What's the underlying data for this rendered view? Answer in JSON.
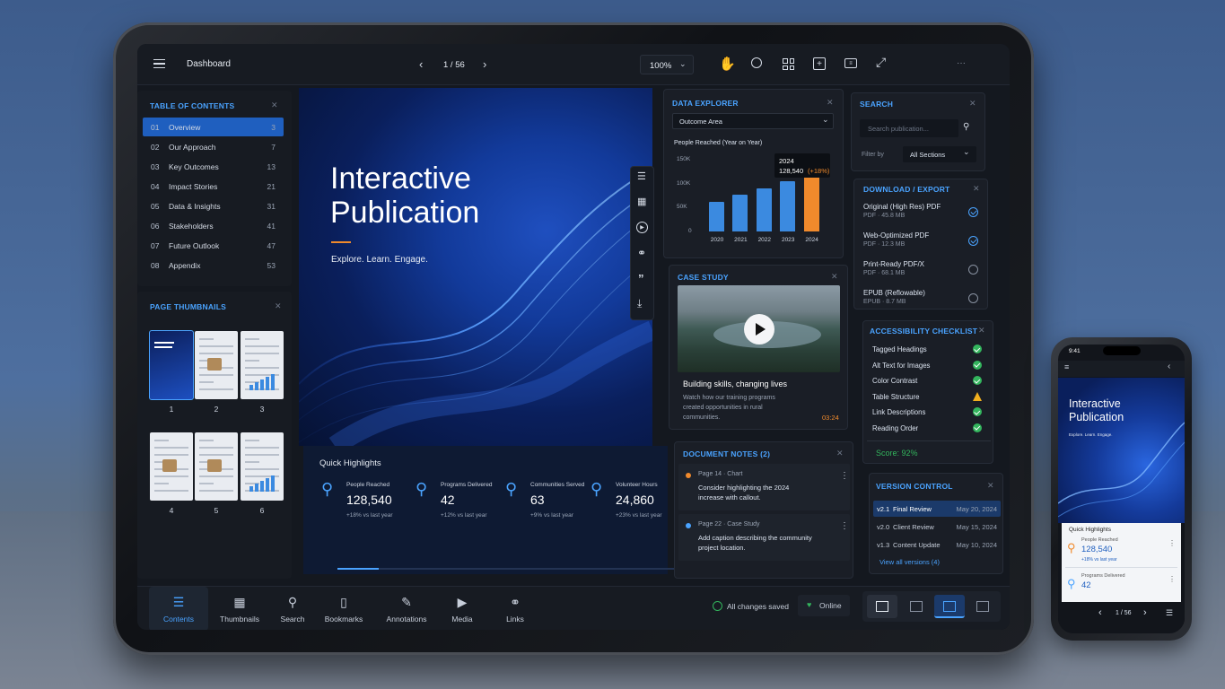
{
  "topbar": {
    "title": "Dashboard",
    "page_indicator": "1 / 56",
    "zoom": "100%",
    "more": "···"
  },
  "toc": {
    "title": "TABLE OF CONTENTS",
    "items": [
      {
        "num": "01",
        "label": "Overview",
        "page": "3"
      },
      {
        "num": "02",
        "label": "Our Approach",
        "page": "7"
      },
      {
        "num": "03",
        "label": "Key Outcomes",
        "page": "13"
      },
      {
        "num": "04",
        "label": "Impact Stories",
        "page": "21"
      },
      {
        "num": "05",
        "label": "Data & Insights",
        "page": "31"
      },
      {
        "num": "06",
        "label": "Stakeholders",
        "page": "41"
      },
      {
        "num": "07",
        "label": "Future Outlook",
        "page": "47"
      },
      {
        "num": "08",
        "label": "Appendix",
        "page": "53"
      }
    ]
  },
  "thumbnails": {
    "title": "PAGE THUMBNAILS",
    "pages": [
      "1",
      "2",
      "3",
      "4",
      "5",
      "6"
    ]
  },
  "hero": {
    "title_line1": "Interactive",
    "title_line2": "Publication",
    "tagline": "Explore. Learn. Engage."
  },
  "highlights": {
    "title": "Quick Highlights",
    "items": [
      {
        "label": "People Reached",
        "value": "128,540",
        "delta": "+18% vs last year"
      },
      {
        "label": "Programs Delivered",
        "value": "42",
        "delta": "+12% vs last year"
      },
      {
        "label": "Communities Served",
        "value": "63",
        "delta": "+9% vs last year"
      },
      {
        "label": "Volunteer Hours",
        "value": "24,860",
        "delta": "+23% vs last year"
      }
    ]
  },
  "data_explorer": {
    "title": "DATA EXPLORER",
    "select": "Outcome Area",
    "chart_title": "People Reached (Year on Year)",
    "tooltip_year": "2024",
    "tooltip_value": "128,540",
    "tooltip_delta": "(+18%)",
    "yticks": [
      "150K",
      "100K",
      "50K",
      "0"
    ]
  },
  "chart_data": {
    "type": "bar",
    "title": "People Reached (Year on Year)",
    "categories": [
      "2020",
      "2021",
      "2022",
      "2023",
      "2024"
    ],
    "values": [
      62000,
      76000,
      90000,
      105000,
      128540
    ],
    "ylim": [
      0,
      150000
    ],
    "highlight_color": "#f08a2c",
    "bar_color": "#3b8ae0"
  },
  "case_study": {
    "title": "CASE STUDY",
    "heading": "Building skills, changing lives",
    "body": "Watch how our training programs created opportunities in rural communities.",
    "duration": "03:24"
  },
  "notes": {
    "title": "DOCUMENT NOTES (2)",
    "items": [
      {
        "meta": "Page 14 · Chart",
        "text": "Consider highlighting the 2024 increase with callout.",
        "color": "#f08a2c"
      },
      {
        "meta": "Page 22 · Case Study",
        "text": "Add caption describing the community project location.",
        "color": "#4aa3ff"
      }
    ]
  },
  "search": {
    "title": "SEARCH",
    "placeholder": "Search publication...",
    "filter_label": "Filter by",
    "filter_value": "All Sections"
  },
  "download": {
    "title": "DOWNLOAD / EXPORT",
    "items": [
      {
        "name": "Original (High Res) PDF",
        "meta": "PDF · 45.8 MB",
        "checked": true
      },
      {
        "name": "Web-Optimized PDF",
        "meta": "PDF · 12.3 MB",
        "checked": true
      },
      {
        "name": "Print-Ready PDF/X",
        "meta": "PDF · 68.1 MB",
        "checked": false
      },
      {
        "name": "EPUB (Reflowable)",
        "meta": "EPUB · 8.7 MB",
        "checked": false
      }
    ]
  },
  "accessibility": {
    "title": "ACCESSIBILITY CHECKLIST",
    "items": [
      {
        "label": "Tagged Headings",
        "status": "ok"
      },
      {
        "label": "Alt Text for Images",
        "status": "ok"
      },
      {
        "label": "Color Contrast",
        "status": "ok"
      },
      {
        "label": "Table Structure",
        "status": "warn"
      },
      {
        "label": "Link Descriptions",
        "status": "ok"
      },
      {
        "label": "Reading Order",
        "status": "ok"
      }
    ],
    "score": "Score: 92%"
  },
  "versions": {
    "title": "VERSION CONTROL",
    "items": [
      {
        "ver": "v2.1",
        "label": "Final Review",
        "date": "May 20, 2024"
      },
      {
        "ver": "v2.0",
        "label": "Client Review",
        "date": "May 15, 2024"
      },
      {
        "ver": "v1.3",
        "label": "Content Update",
        "date": "May 10, 2024"
      }
    ],
    "view_all": "View all versions (4)"
  },
  "bottom_nav": {
    "items": [
      "Contents",
      "Thumbnails",
      "Search",
      "Bookmarks",
      "Annotations",
      "Media",
      "Links"
    ],
    "saved": "All changes saved",
    "online": "Online"
  },
  "phone": {
    "time": "9:41",
    "title_line1": "Interactive",
    "title_line2": "Publication",
    "tagline": "Explore. Learn. Engage.",
    "highlights_title": "Quick Highlights",
    "items": [
      {
        "label": "People Reached",
        "value": "128,540",
        "delta": "+18% vs last year"
      },
      {
        "label": "Programs Delivered",
        "value": "42"
      }
    ],
    "page_indicator": "1 / 56"
  },
  "colors": {
    "accent": "#4aa3ff",
    "orange": "#f08a2c",
    "ok": "#33b55d",
    "warn": "#f2b01e"
  }
}
